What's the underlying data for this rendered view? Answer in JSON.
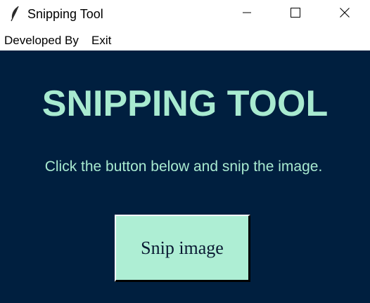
{
  "window": {
    "title": "Snipping Tool",
    "icon": "feather-icon",
    "controls": {
      "minimize": "minimize-icon",
      "maximize": "maximize-icon",
      "close": "close-icon"
    }
  },
  "menubar": {
    "items": [
      {
        "label": "Developed By"
      },
      {
        "label": "Exit"
      }
    ]
  },
  "main": {
    "heading": "SNIPPING TOOL",
    "instruction": "Click the button below and snip the image.",
    "snip_button_label": "Snip image"
  },
  "colors": {
    "content_background": "#001f3f",
    "accent_text": "#a8ead0",
    "button_background": "#aeeed4"
  }
}
